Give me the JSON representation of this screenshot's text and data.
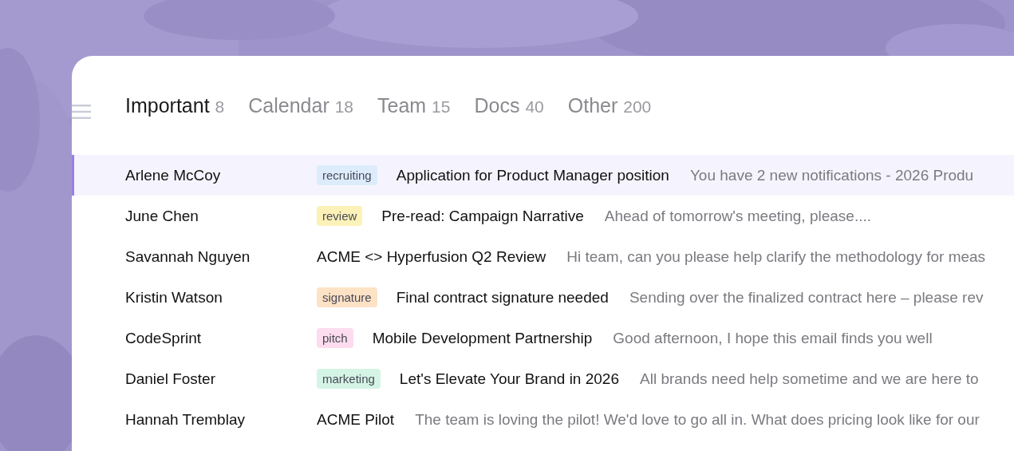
{
  "tabs": [
    {
      "label": "Important",
      "count": "8",
      "selected": true
    },
    {
      "label": "Calendar",
      "count": "18",
      "selected": false
    },
    {
      "label": "Team",
      "count": "15",
      "selected": false
    },
    {
      "label": "Docs",
      "count": "40",
      "selected": false
    },
    {
      "label": "Other",
      "count": "200",
      "selected": false
    }
  ],
  "messages": [
    {
      "sender": "Arlene McCoy",
      "tag": {
        "label": "recruiting",
        "color": "#dcecfb"
      },
      "subject": "Application for Product Manager position",
      "preview": "You have 2 new notifications - 2026 Produ",
      "selected": true
    },
    {
      "sender": "June Chen",
      "tag": {
        "label": "review",
        "color": "#fcf2b8"
      },
      "subject": "Pre-read: Campaign Narrative",
      "preview": "Ahead of tomorrow's meeting, please....",
      "selected": false
    },
    {
      "sender": "Savannah Nguyen",
      "subject": "ACME <> Hyperfusion Q2 Review",
      "preview": "Hi team, can you please help clarify the methodology for meas",
      "selected": false
    },
    {
      "sender": "Kristin Watson",
      "tag": {
        "label": "signature",
        "color": "#fde2c6"
      },
      "subject": "Final contract signature needed",
      "preview": "Sending over the finalized contract here – please rev",
      "selected": false
    },
    {
      "sender": "CodeSprint",
      "tag": {
        "label": "pitch",
        "color": "#fcdcee"
      },
      "subject": "Mobile Development Partnership",
      "preview": "Good afternoon, I hope this email finds you well",
      "selected": false
    },
    {
      "sender": "Daniel Foster",
      "tag": {
        "label": "marketing",
        "color": "#d4f4e6"
      },
      "subject": "Let's Elevate Your Brand in 2026",
      "preview": "All brands need help sometime and we are here to",
      "selected": false
    },
    {
      "sender": "Hannah Tremblay",
      "subject": "ACME Pilot",
      "preview": "The team is loving the pilot! We'd love to go all in. What does pricing look like for our",
      "selected": false
    }
  ]
}
